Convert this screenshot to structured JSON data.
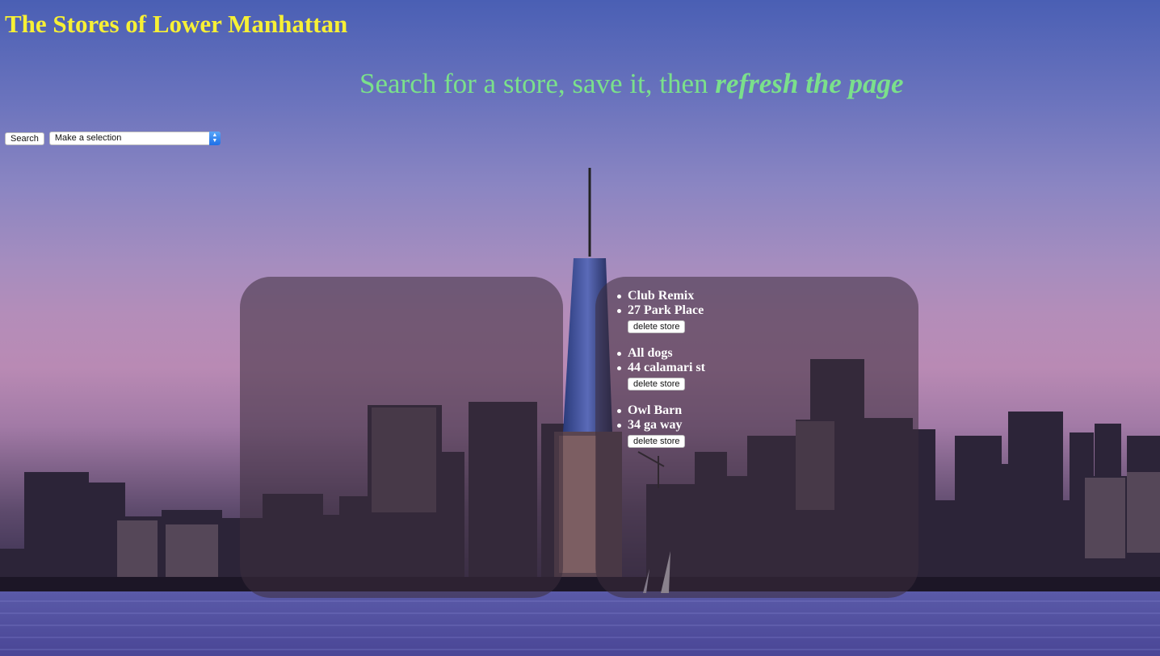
{
  "header": {
    "title": "The Stores of Lower Manhattan",
    "instruction_prefix": "Search for a store, save it, then ",
    "instruction_emphasis": "refresh the page"
  },
  "controls": {
    "search_label": "Search",
    "select_value": "Make a selection",
    "select_arrow_icon": "up-down-chevron-icon"
  },
  "stores": [
    {
      "name": "Club Remix",
      "address": "27 Park Place",
      "delete_label": "delete store"
    },
    {
      "name": "All dogs",
      "address": "44 calamari st",
      "delete_label": "delete store"
    },
    {
      "name": "Owl Barn",
      "address": "34 ga way",
      "delete_label": "delete store"
    }
  ],
  "colors": {
    "title": "#f7f035",
    "instruction": "#7be08b",
    "store_text": "#ffffff",
    "select_accent": "#1d6fe8"
  }
}
